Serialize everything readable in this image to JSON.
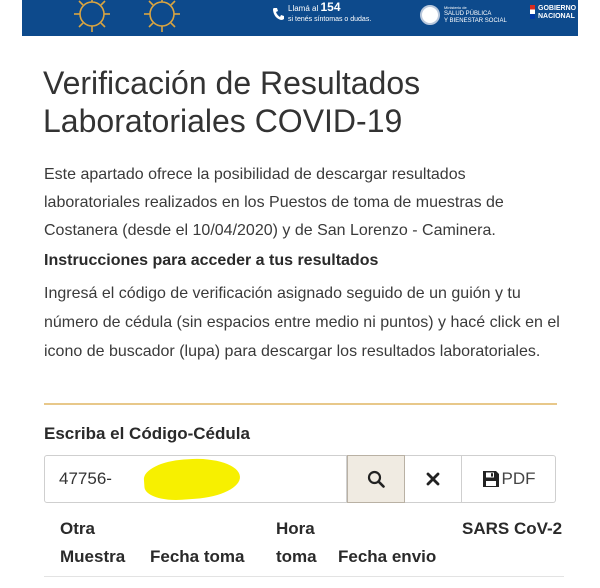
{
  "banner": {
    "phone_line1": "Llamá al",
    "phone_number": "154",
    "phone_line2": "si tenés síntomas o dudas.",
    "ministry_small": "Ministerio de",
    "ministry_line1": "SALUD PÚBLICA",
    "ministry_line2": "Y BIENESTAR SOCIAL",
    "gov_line1": "GOBIERNO",
    "gov_line2": "NACIONAL"
  },
  "page": {
    "title": "Verificación de Resultados Laboratoriales COVID-19",
    "intro": "Este apartado ofrece la posibilidad de descargar resultados laboratoriales realizados en los Puestos de toma de muestras de Costanera (desde el 10/04/2020) y de San Lorenzo - Caminera.",
    "instructions_title": "Instrucciones para acceder a tus resultados",
    "instructions_text": "Ingresá el código de verificación asignado seguido de un guión y tu número de cédula (sin espacios entre medio ni puntos) y hacé click en el icono de buscador (lupa) para descargar los resultados laboratoriales."
  },
  "form": {
    "label": "Escriba el Código-Cédula",
    "value": "47756-",
    "pdf_label": "PDF"
  },
  "table": {
    "headers": {
      "otra_muestra": "Otra Muestra",
      "fecha_toma": "Fecha toma",
      "hora_toma": "Hora toma",
      "fecha_envio": "Fecha envio",
      "sars_cov2": "SARS CoV-2"
    }
  },
  "colors": {
    "banner": "#0d4a8c",
    "divider": "#e8c88a",
    "search_button_bg": "#f0ebe2"
  },
  "icons": [
    "virus-icon",
    "phone-icon",
    "seal-icon",
    "flag-icon",
    "search-icon",
    "close-icon",
    "save-icon"
  ]
}
